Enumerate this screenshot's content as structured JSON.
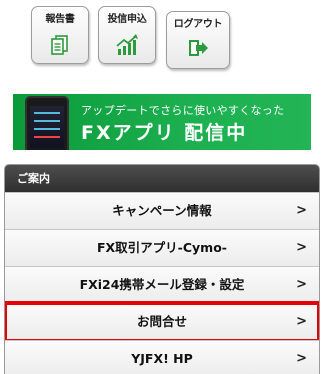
{
  "top_buttons": [
    {
      "label": "報告書",
      "icon": "report-icon"
    },
    {
      "label": "投信申込",
      "icon": "chart-icon"
    },
    {
      "label": "ログアウト",
      "icon": "logout-icon"
    }
  ],
  "banner": {
    "line1": "アップデートでさらに使いやすくなった",
    "line2_a": "FXアプリ",
    "line2_b": " 配信中"
  },
  "menu": {
    "header": "ご案内",
    "items": [
      {
        "label": "キャンペーン情報"
      },
      {
        "label": "FX取引アプリ-Cymo-"
      },
      {
        "label": "FXi24携帯メール登録・設定"
      },
      {
        "label": "お問合せ"
      },
      {
        "label": "YJFX! HP"
      }
    ],
    "chevron": ">"
  },
  "colors": {
    "banner_green": "#1db050",
    "highlight_red": "#e60000",
    "header_dark": "#3a3a3a"
  }
}
